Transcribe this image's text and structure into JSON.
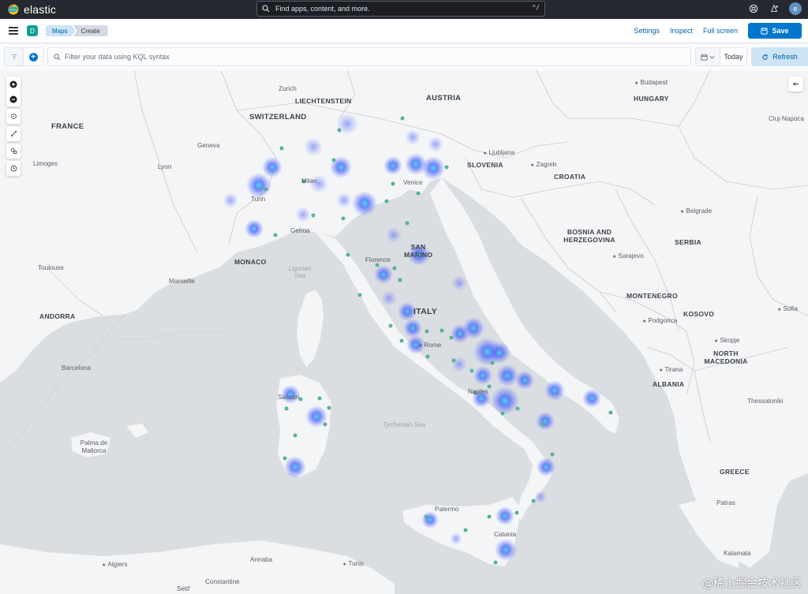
{
  "app": {
    "brand": "elastic",
    "search_placeholder": "Find apps, content, and more.",
    "search_shortcut": "^/",
    "avatar_initial": "e",
    "space_initial": "D"
  },
  "breadcrumbs": [
    "Maps",
    "Create"
  ],
  "header_links": {
    "settings": "Settings",
    "inspect": "Inspect",
    "full_screen": "Full screen",
    "save": "Save"
  },
  "query": {
    "placeholder": "Filter your data using KQL syntax",
    "date_label": "Today",
    "refresh_label": "Refresh"
  },
  "map_labels": {
    "countries": [
      "FRANCE",
      "SWITZERLAND",
      "LIECHTENSTEIN",
      "AUSTRIA",
      "HUNGARY",
      "SLOVENIA",
      "CROATIA",
      "BOSNIA AND HERZEGOVINA",
      "SERBIA",
      "MONTENEGRO",
      "KOSOVO",
      "NORTH MACEDONIA",
      "ALBANIA",
      "GREECE",
      "ITALY",
      "SAN MARINO",
      "MONACO",
      "ANDORRA"
    ],
    "cities": [
      "Budapest",
      "Zurich",
      "Cluj-Napoca",
      "Geneva",
      "Limoges",
      "Lyon",
      "Milan",
      "Turin",
      "Genoa",
      "Venice",
      "Ljubljana",
      "Zagreb",
      "Florence",
      "Belgrade",
      "Sarajevo",
      "Toulouse",
      "Marseille",
      "Podgorica",
      "Sofia",
      "Rome",
      "Skopje",
      "Tirana",
      "Naples",
      "Barcelona",
      "Sassari",
      "Thessaloniki",
      "Palma de Mallorca",
      "Palermo",
      "Catania",
      "Patras",
      "Algiers",
      "Annaba",
      "Tunis",
      "Kalamata",
      "Constantine",
      "Setif"
    ],
    "seas": [
      "Ligurian Sea",
      "Tyrrhenian Sea"
    ]
  },
  "colors": {
    "topbar": "#25282f",
    "accent": "#0077cc",
    "heat": "#4f6bf7",
    "point": "#54b399"
  },
  "watermark": "@稀土掘金技术社区"
}
